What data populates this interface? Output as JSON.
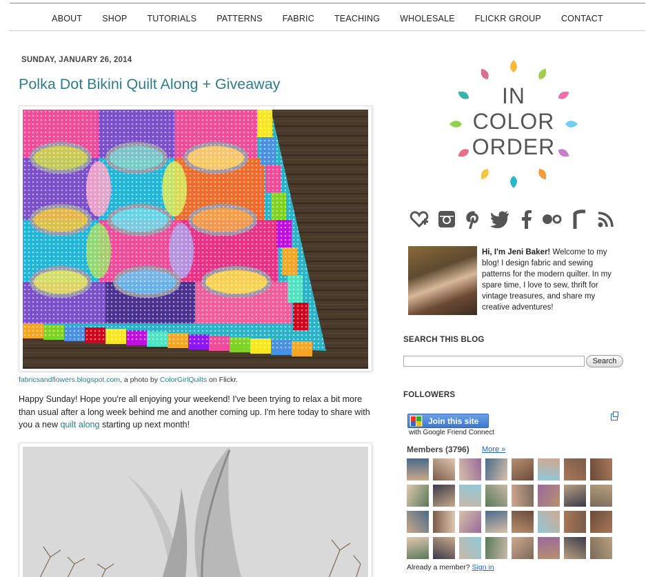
{
  "nav": [
    "ABOUT",
    "SHOP",
    "TUTORIALS",
    "PATTERNS",
    "FABRIC",
    "TEACHING",
    "WHOLESALE",
    "FLICKR GROUP",
    "CONTACT"
  ],
  "post": {
    "date": "SUNDAY, JANUARY 26, 2014",
    "title": "Polka Dot Bikini Quilt Along + Giveaway",
    "caption": {
      "source_link": "fabricsandflowers.blogspot.com",
      "middle": ", a photo by ",
      "author_link": "ColorGirlQuilts",
      "end": " on Flickr."
    },
    "body": {
      "text_before": "Happy Sunday! Hope you're all enjoying your weekend! I've been trying to relax a bit more than usual after a long week behind me and another coming up.  I'm here today to share with you a new ",
      "link": "quilt along",
      "text_after": " starting up next month!"
    }
  },
  "sidebar": {
    "logo": [
      "IN",
      "COLOR",
      "ORDER"
    ],
    "logo_colors": [
      "#f6b93b",
      "#a2cf4a",
      "#f06ea9",
      "#6ccff6",
      "#c67fc9",
      "#f39c3c",
      "#2ab7c9",
      "#f4c542",
      "#e86d8a",
      "#8fd14f",
      "#3bb3a9",
      "#d8708f"
    ],
    "social_icons": [
      "bloglovin-icon",
      "instagram-icon",
      "pinterest-icon",
      "twitter-icon",
      "facebook-icon",
      "flickr-icon",
      "ravelry-icon",
      "rss-icon"
    ],
    "bio_name": "Hi, I'm Jeni Baker!",
    "bio_text": " Welcome to my blog! I design fabric and sewing patterns for the modern quilter. In my spare time, I love to sew, thrift for vintage treasures, and share my creative adventures!",
    "search_heading": "SEARCH THIS BLOG",
    "search_button": "Search",
    "followers_heading": "FOLLOWERS",
    "join_label": "Join this site",
    "join_sub": "with Google Friend Connect",
    "members_label": "Members (3796)",
    "more_label": "More »",
    "already_text": "Already a member? ",
    "sign_in": "Sign in"
  }
}
